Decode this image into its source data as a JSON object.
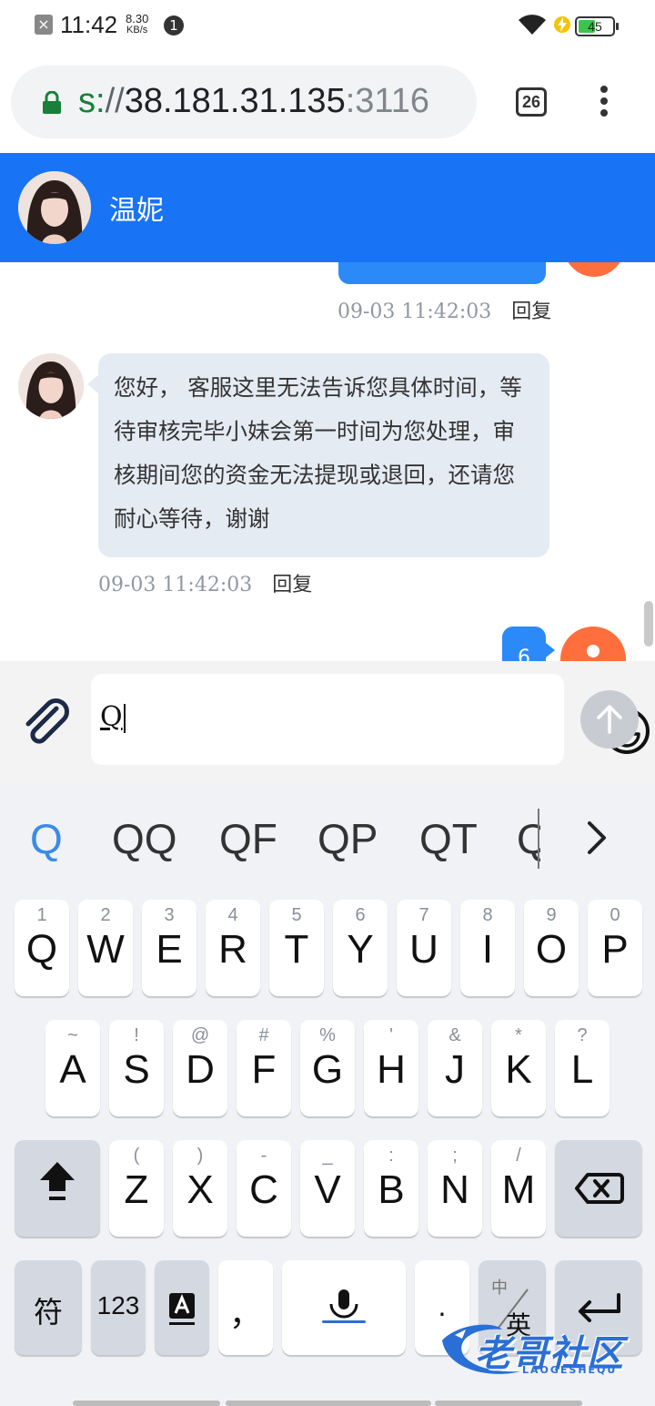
{
  "status_bar": {
    "time": "11:42",
    "net_speed_value": "8.30",
    "net_speed_unit": "KB/s",
    "notification_count": "1",
    "battery_level": "45"
  },
  "browser": {
    "url_scheme": "s:",
    "url_slashes": "//",
    "url_host": "38.181.31.135",
    "url_port": ":3116",
    "tab_count": "26"
  },
  "chat": {
    "contact_name": "温妮",
    "messages": [
      {
        "direction": "outgoing",
        "time": "09-03 11:42:03",
        "reply_label": "回复"
      },
      {
        "direction": "incoming",
        "text": "您好， 客服这里无法告诉您具体时间，等待审核完毕小妹会第一时间为您处理，审核期间您的资金无法提现或退回，还请您耐心等待，谢谢",
        "time": "09-03 11:42:03",
        "reply_label": "回复"
      },
      {
        "direction": "outgoing",
        "text": "6"
      }
    ]
  },
  "composer": {
    "input_value": "Q"
  },
  "keyboard": {
    "suggestions": [
      "Q",
      "QQ",
      "QF",
      "QP",
      "QT",
      "Q"
    ],
    "row1": [
      {
        "key": "Q",
        "sub": "1"
      },
      {
        "key": "W",
        "sub": "2"
      },
      {
        "key": "E",
        "sub": "3"
      },
      {
        "key": "R",
        "sub": "4"
      },
      {
        "key": "T",
        "sub": "5"
      },
      {
        "key": "Y",
        "sub": "6"
      },
      {
        "key": "U",
        "sub": "7"
      },
      {
        "key": "I",
        "sub": "8"
      },
      {
        "key": "O",
        "sub": "9"
      },
      {
        "key": "P",
        "sub": "0"
      }
    ],
    "row2": [
      {
        "key": "A",
        "sub": "~"
      },
      {
        "key": "S",
        "sub": "!"
      },
      {
        "key": "D",
        "sub": "@"
      },
      {
        "key": "F",
        "sub": "#"
      },
      {
        "key": "G",
        "sub": "%"
      },
      {
        "key": "H",
        "sub": "'"
      },
      {
        "key": "J",
        "sub": "&"
      },
      {
        "key": "K",
        "sub": "*"
      },
      {
        "key": "L",
        "sub": "?"
      }
    ],
    "row3": [
      {
        "key": "Z",
        "sub": "("
      },
      {
        "key": "X",
        "sub": ")"
      },
      {
        "key": "C",
        "sub": "-"
      },
      {
        "key": "V",
        "sub": "_"
      },
      {
        "key": "B",
        "sub": ":"
      },
      {
        "key": "N",
        "sub": ";"
      },
      {
        "key": "M",
        "sub": "/"
      }
    ],
    "symbols_key": "符",
    "numbers_key": "123",
    "comma_key": "，",
    "period_key": ".",
    "lang_key_top": "中",
    "lang_key_bottom": "英"
  },
  "watermark": {
    "text": "老哥社区",
    "sub": "LAOGESHEQU"
  },
  "colors": {
    "header_blue": "#1874f5",
    "bubble_out": "#2b8af7",
    "bubble_in": "#e5ebf3",
    "avatar_orange": "#ff6f3d",
    "suggestion_active": "#3b8be6"
  }
}
